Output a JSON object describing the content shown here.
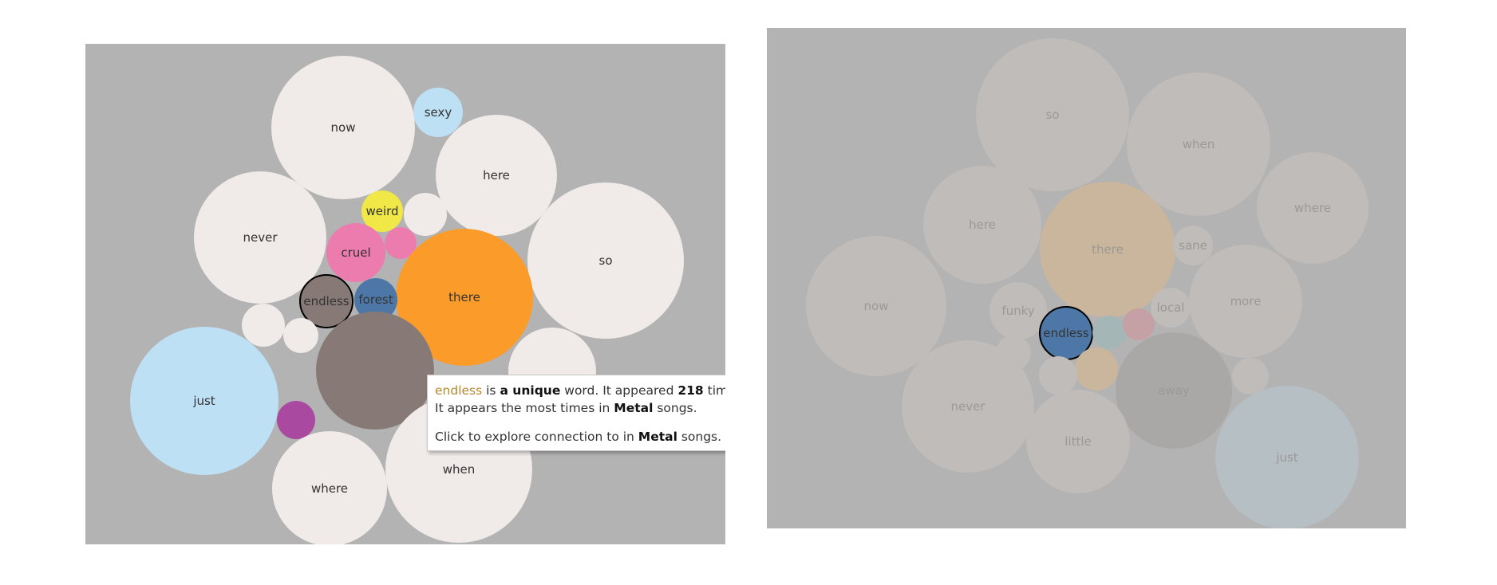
{
  "colors": {
    "panel_bg": "#b3b3b3",
    "default_bubble": "#f0eae8",
    "highlight_stroke": "#000000",
    "tooltip_word": "#b5892c"
  },
  "left_chart": {
    "bubbles": [
      {
        "label": "now",
        "color": "#f0eae8"
      },
      {
        "label": "sexy",
        "color": "#bde0f5"
      },
      {
        "label": "here",
        "color": "#f0eae8"
      },
      {
        "label": "weird",
        "color": "#f0e847"
      },
      {
        "label": "",
        "color": "#f0eae8"
      },
      {
        "label": "never",
        "color": "#f0eae8"
      },
      {
        "label": "cruel",
        "color": "#ec7bae"
      },
      {
        "label": "",
        "color": "#ec7bae"
      },
      {
        "label": "so",
        "color": "#f0eae8"
      },
      {
        "label": "there",
        "color": "#fb9b2a"
      },
      {
        "label": "endless",
        "color": "#877a76",
        "selected": true
      },
      {
        "label": "forest",
        "color": "#4c77a6"
      },
      {
        "label": "",
        "color": "#f0eae8"
      },
      {
        "label": "",
        "color": "#f0eae8"
      },
      {
        "label": "just",
        "color": "#bde0f5"
      },
      {
        "label": "",
        "color": "#877a76"
      },
      {
        "label": "",
        "color": "#f0eae8"
      },
      {
        "label": "",
        "color": "#a94aa0"
      },
      {
        "label": "where",
        "color": "#f0eae8"
      },
      {
        "label": "when",
        "color": "#f0eae8"
      }
    ]
  },
  "right_chart": {
    "bubbles": [
      {
        "label": "so",
        "color": "#c0bcba"
      },
      {
        "label": "when",
        "color": "#c0bcba"
      },
      {
        "label": "where",
        "color": "#c0bcba"
      },
      {
        "label": "here",
        "color": "#c0bcba"
      },
      {
        "label": "there",
        "color": "#c9b69c"
      },
      {
        "label": "sane",
        "color": "#c0bcba"
      },
      {
        "label": "now",
        "color": "#c0bcba"
      },
      {
        "label": "funky",
        "color": "#c0bcba"
      },
      {
        "label": "local",
        "color": "#c0bcba"
      },
      {
        "label": "more",
        "color": "#c0bcba"
      },
      {
        "label": "endless",
        "color": "#4c77a6",
        "selected": true
      },
      {
        "label": "",
        "color": "#a5b6b6"
      },
      {
        "label": "",
        "color": "#c5a1a6"
      },
      {
        "label": "",
        "color": "#c0bcba"
      },
      {
        "label": "",
        "color": "#c9b69c"
      },
      {
        "label": "",
        "color": "#c0bcba"
      },
      {
        "label": "",
        "color": "#c0bcba"
      },
      {
        "label": "never",
        "color": "#c0bcba"
      },
      {
        "label": "away",
        "color": "#aaa8a6"
      },
      {
        "label": "little",
        "color": "#c0bcba"
      },
      {
        "label": "just",
        "color": "#b5bfc4"
      }
    ]
  },
  "tooltip": {
    "word": "endless",
    "t1": " is ",
    "unique": "a unique",
    "t2": " word. It appeared ",
    "count": "218",
    "t3": " times.",
    "t4": "It appears the most times in ",
    "genre1": "Metal",
    "t5": " songs.",
    "t6": "Click to explore connection to in ",
    "genre2": "Metal",
    "t7": " songs."
  }
}
